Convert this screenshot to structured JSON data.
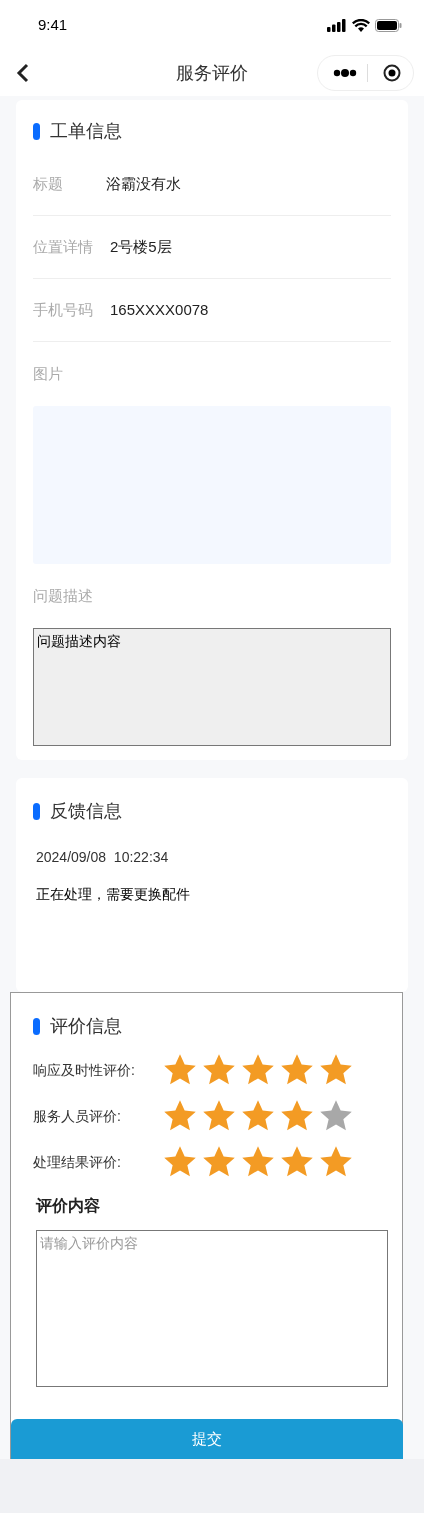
{
  "status_bar": {
    "time": "9:41"
  },
  "nav": {
    "title": "服务评价"
  },
  "order_info": {
    "title": "工单信息",
    "fields": [
      {
        "label": "标题",
        "value": "浴霸没有水"
      },
      {
        "label": "位置详情",
        "value": "2号楼5层"
      },
      {
        "label": "手机号码",
        "value": "165XXXX0078"
      }
    ],
    "picture_label": "图片",
    "description_label": "问题描述",
    "description": "问题描述内容"
  },
  "feedback": {
    "title": "反馈信息",
    "time": "2024/09/08  10:22:34",
    "message": "正在处理，需要更换配件"
  },
  "rating": {
    "title": "评价信息",
    "items": [
      {
        "label": "响应及时性评价:",
        "stars": 5
      },
      {
        "label": "服务人员评价:",
        "stars": 4
      },
      {
        "label": "处理结果评价:",
        "stars": 5
      }
    ],
    "content_label": "评价内容",
    "content_placeholder": "请输入评价内容"
  },
  "submit": "提交"
}
